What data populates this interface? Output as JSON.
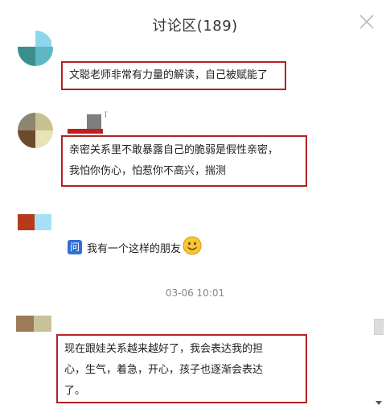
{
  "header": {
    "title": "讨论区(189)"
  },
  "comments": [
    {
      "text": "文聪老师非常有力量的解读，自己被赋能了"
    },
    {
      "name_fragment": "ǐ",
      "lines": [
        "亲密关系里不敢暴露自己的脆弱是假性亲密，",
        "我怕你伤心，怕惹你不高兴，揣测"
      ]
    },
    {
      "badge": "问",
      "text": "我有一个这样的朋友",
      "emoji": "smiling-face-emoji"
    },
    {
      "lines": [
        "现在跟娃关系越来越好了，我会表达我的担",
        "心，生气，着急，开心，孩子也逐渐会表达",
        "了。"
      ]
    }
  ],
  "timestamp": "03-06 10:01",
  "colors": {
    "highlight_border": "#b22222",
    "badge_blue": "#2f6fd6"
  },
  "icons": {
    "close": "close-icon",
    "scroll_down": "chevron-down-icon"
  }
}
